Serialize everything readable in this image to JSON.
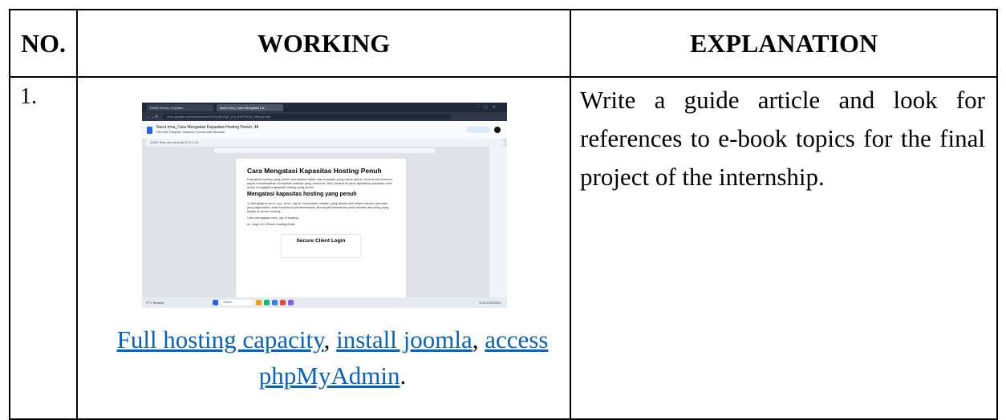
{
  "headers": {
    "no": "NO.",
    "working": "WORKING",
    "explanation": "EXPLANATION"
  },
  "row": {
    "number": "1.",
    "links": [
      "Full hosting capacity",
      "install joomla",
      "access phpMyAdmin"
    ],
    "separator": ", ",
    "terminal": ".",
    "explanation": "Write a guide article and look for references to e-book topics for the final project of the internship."
  },
  "screenshot": {
    "tabs": [
      "Detail Rincian Kegiatan",
      "Nurul Irma_Cara Mengatasi Ka..."
    ],
    "url": "docs.google.com/document/d/12Kyuf9U5yE_Dry-KNTFBUd_9Rtwyx/edit",
    "doc_title": "Nurul Irma_Cara Mengatasi Kapasitas Hosting Penuh. 48",
    "menu": "File  Edit  Tampilan  Sisipkan  Format  Alat  Bantuan",
    "toolbar": "100%  Teks normal  Arial  11  B  I  U  A",
    "page_title": "Cara Mengatasi Kapasitas Hosting Penuh",
    "page_para1": "Kapasitas hosting yang penuh merupakan salah satu masalah yang cukup serius. Karena hal tersebut dapat menyebabkan kecepatan website yang menurun. Nah, berikut ini akan dijelaskan panduan cara untuk mengatasi kapasitas hosting yang penuh.",
    "page_heading": "Mengatasi kapasitas hosting yang penuh",
    "page_para2": "1) Menghapus error_log : error_log ini merupakan catatan yang dibuat oleh sistem secara otomatis yang digunakan untuk keperluan pemberitahuan jika terjadi kesalahan pada website atau blog yang terjadi di server hosting.",
    "page_para3": "Cara mengatasi error_log di hosting.",
    "page_para4": "a). Login ke CPanel hosting Anda",
    "login_title": "Secure Client Login",
    "weather": "27°C Berawan",
    "search": "Search",
    "clock": "10:19 11/01/2024"
  }
}
